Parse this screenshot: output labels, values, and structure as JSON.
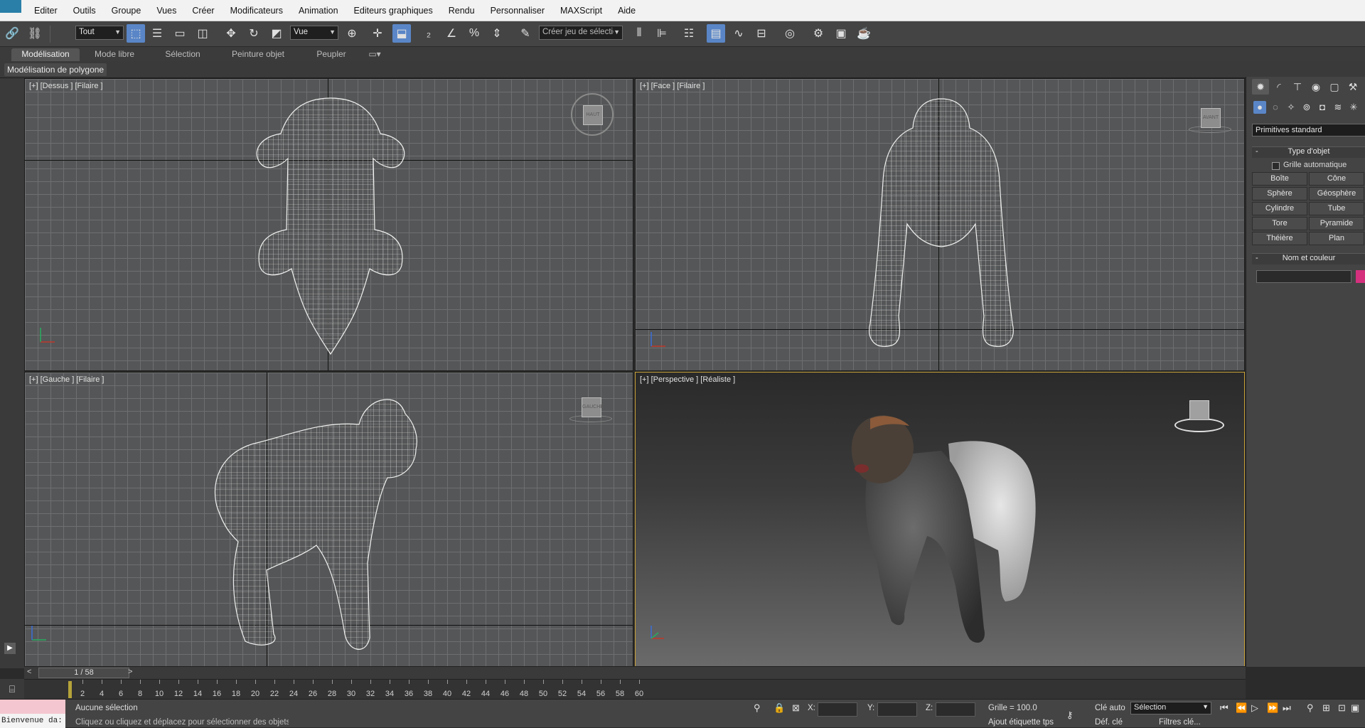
{
  "menubar": {
    "items": [
      "Editer",
      "Outils",
      "Groupe",
      "Vues",
      "Créer",
      "Modificateurs",
      "Animation",
      "Editeurs graphiques",
      "Rendu",
      "Personnaliser",
      "MAXScript",
      "Aide"
    ]
  },
  "toolbar": {
    "selection_filter": "Tout",
    "ref_coord": "Vue",
    "named_selection_placeholder": "Créer jeu de sélection"
  },
  "ribbon": {
    "tabs": [
      "Modélisation",
      "Mode libre",
      "Sélection",
      "Peinture objet",
      "Peupler"
    ],
    "active_tab": "Modélisation",
    "sub_label": "Modélisation de polygone"
  },
  "viewports": {
    "top": {
      "label": "[+] [Dessus ] [Filaire ]",
      "cube": "HAUT"
    },
    "front": {
      "label": "[+] [Face ] [Filaire ]",
      "cube": "AVANT"
    },
    "left": {
      "label": "[+] [Gauche ] [Filaire ]",
      "cube": "GAUCHE"
    },
    "perspective": {
      "label": "[+] [Perspective ] [Réaliste ]",
      "cube": ""
    }
  },
  "command_panel": {
    "dropdown": "Primitives standard",
    "object_type_title": "Type d'objet",
    "auto_grid": "Grille automatique",
    "primitives": [
      "Boîte",
      "Cône",
      "Sphère",
      "Géosphère",
      "Cylindre",
      "Tube",
      "Tore",
      "Pyramide",
      "Théière",
      "Plan"
    ],
    "name_color_title": "Nom et couleur",
    "object_color": "#d4307e"
  },
  "timeline": {
    "frame_display": "1 / 58",
    "ticks": [
      "2",
      "4",
      "6",
      "8",
      "10",
      "12",
      "14",
      "16",
      "18",
      "20",
      "22",
      "24",
      "26",
      "28",
      "30",
      "32",
      "34",
      "36",
      "38",
      "40",
      "42",
      "44",
      "46",
      "48",
      "50",
      "52",
      "54",
      "56",
      "58",
      "60"
    ]
  },
  "statusbar": {
    "welcome": "Bienvenue da:",
    "selection_status": "Aucune sélection",
    "prompt": "Cliquez ou cliquez et déplacez pour sélectionner des objets",
    "x_label": "X:",
    "y_label": "Y:",
    "z_label": "Z:",
    "grid": "Grille = 100.0",
    "auto_key": "Clé auto",
    "set_key": "Déf. clé",
    "key_mode": "Sélection",
    "key_filters": "Filtres clé...",
    "add_time_tag": "Ajout étiquette tps"
  }
}
